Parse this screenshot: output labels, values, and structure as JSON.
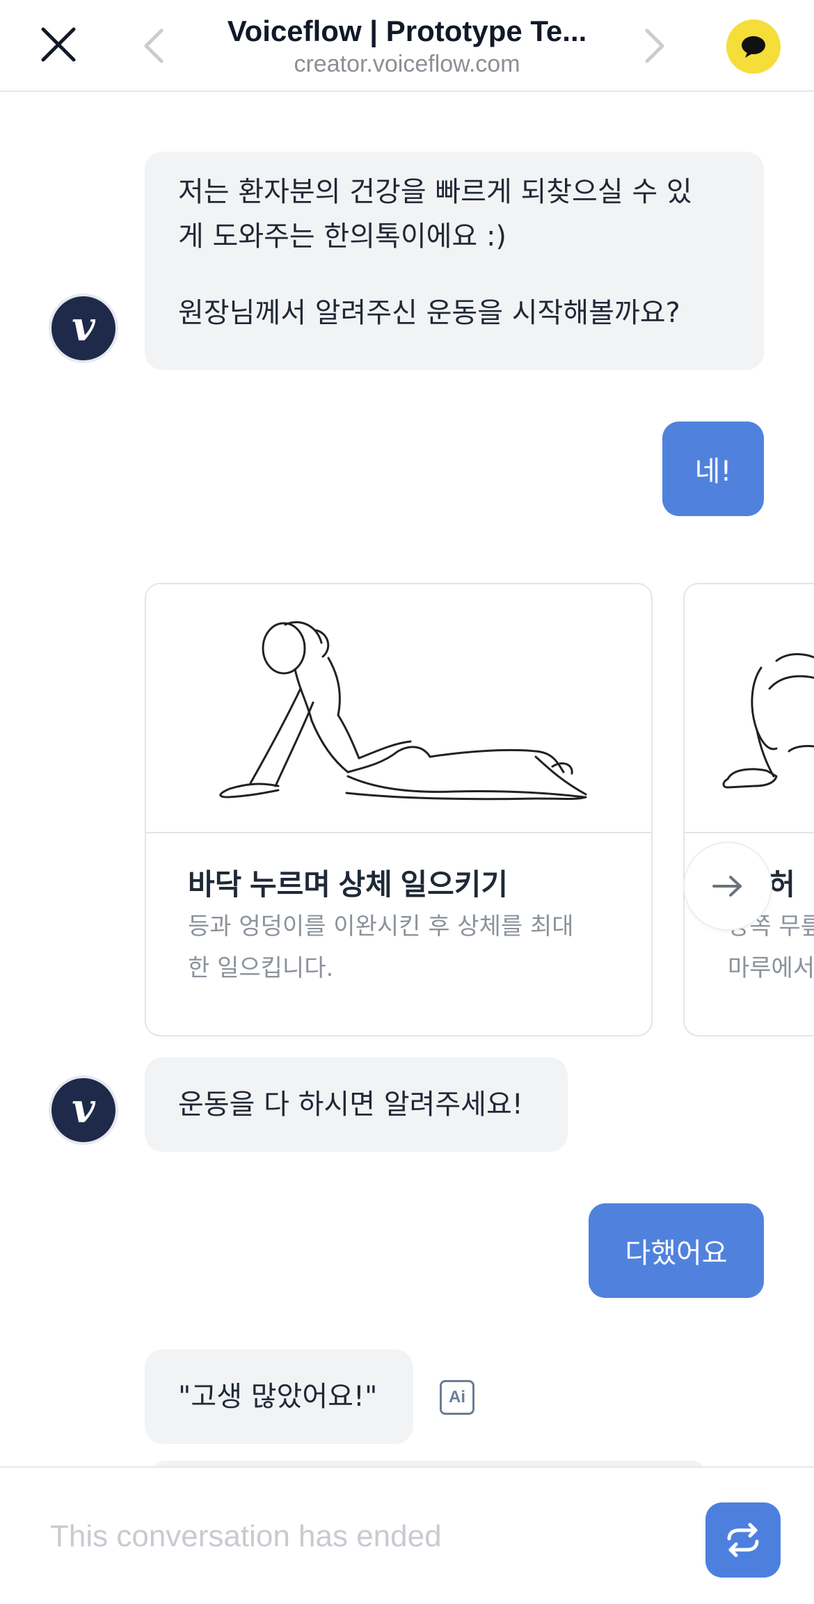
{
  "browser": {
    "title": "Voiceflow | Prototype Te...",
    "url": "creator.voiceflow.com",
    "accent": "#f5dd3a"
  },
  "avatar_letter": "v",
  "messages": [
    {
      "role": "bot",
      "lines": [
        "저는 환자분의 건강을 빠르게 되찾으실 수 있",
        "게 도와주는 한의톡이에요 :)",
        "",
        "원장님께서 알려주신 운동을 시작해볼까요?"
      ]
    },
    {
      "role": "user",
      "text": "네!"
    },
    {
      "role": "bot",
      "text": "운동을 다 하시면 알려주세요!"
    },
    {
      "role": "user",
      "text": "다했어요"
    },
    {
      "role": "bot",
      "text": "\"고생 많았어요!\""
    }
  ],
  "cards": [
    {
      "title": "바닥 누르며 상체 일으키기",
      "desc_lines": [
        "등과 엉덩이를 이완시킨 후 상체를 최대",
        "한 일으킵니다."
      ]
    },
    {
      "title": "한 허",
      "desc_lines": [
        "양쪽 무릎",
        "마루에서"
      ]
    }
  ],
  "ai_badge": "Ai",
  "footer": {
    "status": "This conversation has ended"
  },
  "colors": {
    "user_bubble": "#5082dd",
    "bot_bubble": "#f2f3f4",
    "restart_button": "#4d80de"
  }
}
